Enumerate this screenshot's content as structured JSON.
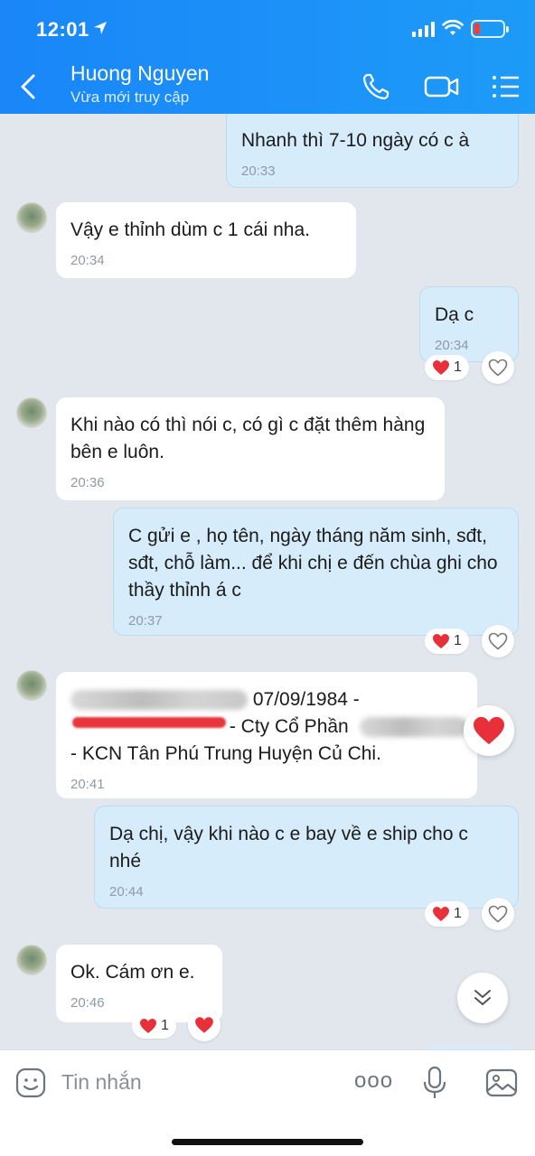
{
  "status_bar": {
    "time": "12:01",
    "battery_color": "#ff3b30"
  },
  "header": {
    "contact_name": "Huong Nguyen",
    "contact_status": "Vừa mới truy cập",
    "icons": [
      "back-arrow-icon",
      "phone-icon",
      "video-call-icon",
      "menu-icon"
    ],
    "accent": "#1a8ef8"
  },
  "messages": [
    {
      "dir": "out",
      "text": "Nhanh thì 7-10 ngày có c à",
      "time": "20:33"
    },
    {
      "dir": "in",
      "text": "Vậy e thỉnh dùm c 1 cái nha.",
      "time": "20:34"
    },
    {
      "dir": "out",
      "text": "Dạ c",
      "time": "20:34",
      "reaction_count": "1"
    },
    {
      "dir": "in",
      "text": "Khi nào có thì nói c, có gì c đặt thêm hàng bên e luôn.",
      "time": "20:36"
    },
    {
      "dir": "out",
      "text": "C gửi e , họ tên, ngày tháng năm sinh, sđt, sđt, chỗ làm... để khi chị e đến chùa ghi cho thầy thỉnh á c",
      "time": "20:37",
      "reaction_count": "1"
    },
    {
      "dir": "in",
      "line1_visible": "07/09/1984 -",
      "line2_visible": "- Cty Cổ Phần",
      "line3": "- KCN Tân Phú Trung Huyện Củ Chi.",
      "time": "20:41"
    },
    {
      "dir": "out",
      "text": "Dạ chị, vậy khi nào c e bay về e ship cho c nhé",
      "time": "20:44",
      "reaction_count": "1"
    },
    {
      "dir": "in",
      "text": "Ok. Cám ơn e.",
      "time": "20:46",
      "reaction_count": "1"
    }
  ],
  "input": {
    "placeholder": "Tin nhắn",
    "more_label": "ooo"
  }
}
